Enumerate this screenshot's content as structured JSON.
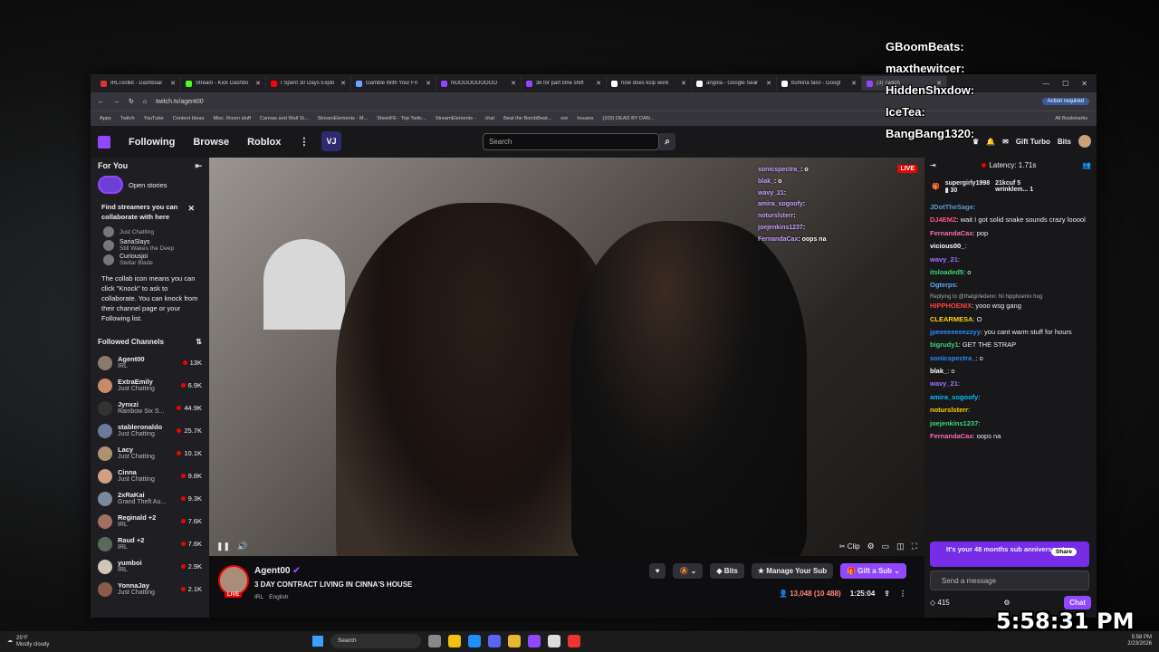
{
  "browser": {
    "tabs": [
      {
        "title": "IRLToolkit - Dashboar",
        "color": "#d33"
      },
      {
        "title": "Stream - Kick Dashbo",
        "color": "#53fc18"
      },
      {
        "title": "I Spent 30 Days Explo",
        "color": "#f00"
      },
      {
        "title": "Gamble With Your Fri",
        "color": "#6af"
      },
      {
        "title": "NOOOOOOOOOO",
        "color": "#9147ff"
      },
      {
        "title": "3k for part time shift",
        "color": "#9147ff"
      },
      {
        "title": "how does kcip work",
        "color": "#fff"
      },
      {
        "title": "angola - Google Sear",
        "color": "#fff"
      },
      {
        "title": "burkina faso - Googl",
        "color": "#fff"
      },
      {
        "title": "(3) Twitch",
        "color": "#9147ff"
      }
    ],
    "url": "twitch.tv/agent00",
    "action_required": "Action required",
    "bookmarks": [
      "Apps",
      "Twitch",
      "YouTube",
      "Content Ideas",
      "Misc. Room stuff",
      "Canvas and Wall St...",
      "StreamElements - M...",
      "SheetFE - Top Twitc...",
      "StreamElements -",
      "chat",
      "Beat the BombBeat...",
      "oor",
      "houses",
      "(103) DEAD BY DAN..."
    ],
    "all_bookmarks": "All Bookmarks"
  },
  "nav": {
    "following": "Following",
    "browse": "Browse",
    "roblox": "Roblox",
    "more": "⋮",
    "extension": "VJ",
    "search_placeholder": "Search",
    "gift_turbo": "Gift Turbo",
    "bits": "Bits"
  },
  "sidebar": {
    "for_you": "For You",
    "open_stories": "Open stories",
    "collab_heading": "Find streamers you can collaborate with here",
    "collab_list": [
      {
        "name": "",
        "sub": "Just Chatting"
      },
      {
        "name": "SariaSlays",
        "sub": "Still Wakes the Deep"
      },
      {
        "name": "Curiousjoi",
        "sub": "Stellar Blade"
      }
    ],
    "collab_text": "The collab icon means you can click \"Knock\" to ask to collaborate. You can knock from their channel page or your Following list.",
    "followed_heading": "Followed Channels",
    "channels": [
      {
        "name": "Agent00",
        "game": "IRL",
        "viewers": "13K"
      },
      {
        "name": "ExtraEmily",
        "game": "Just Chatting",
        "viewers": "6.9K"
      },
      {
        "name": "Jynxzi",
        "game": "Rainbow Six S...",
        "viewers": "44.9K"
      },
      {
        "name": "stableronaldo",
        "game": "Just Chatting",
        "viewers": "25.7K"
      },
      {
        "name": "Lacy",
        "game": "Just Chatting",
        "viewers": "10.1K"
      },
      {
        "name": "Cinna",
        "game": "Just Chatting",
        "viewers": "9.8K"
      },
      {
        "name": "2xRaKai",
        "game": "Grand Theft Au...",
        "viewers": "9.3K"
      },
      {
        "name": "Reginald +2",
        "game": "IRL",
        "viewers": "7.6K"
      },
      {
        "name": "Raud +2",
        "game": "IRL",
        "viewers": "7.6K"
      },
      {
        "name": "yumboi",
        "game": "IRL",
        "viewers": "2.9K"
      },
      {
        "name": "YonnaJay",
        "game": "Just Chatting",
        "viewers": "2.1K"
      }
    ]
  },
  "video": {
    "live": "LIVE",
    "clip": "Clip",
    "overlay_chat": [
      {
        "user": "sonicspectra_",
        "text": ": o"
      },
      {
        "user": "blak_",
        "text": ": o"
      },
      {
        "user": "wavy_21",
        "text": ":"
      },
      {
        "user": "amira_sogoofy",
        "text": ":"
      },
      {
        "user": "noturslsterr",
        "text": ":"
      },
      {
        "user": "joejenkins1237",
        "text": ":"
      },
      {
        "user": "FernandaCax",
        "text": ": oops na"
      }
    ]
  },
  "info": {
    "channel": "Agent00",
    "live": "LIVE",
    "title": "3 DAY CONTRACT LIVING IN CINNA'S HOUSE",
    "tags": [
      "IRL",
      "English"
    ],
    "bits": "Bits",
    "manage_sub": "Manage Your Sub",
    "gift_sub": "Gift a Sub",
    "viewers": "13,048 (10 488)",
    "uptime": "1:25:04"
  },
  "chat": {
    "latency": "Latency: 1.71s",
    "gifter1": {
      "name": "supergirly1998",
      "count": "30"
    },
    "gifter2": {
      "name": "21kcuf",
      "count": "5"
    },
    "gifter3": {
      "name": "wrinklem...",
      "count": "1"
    },
    "messages": [
      {
        "user": "JDotTheSage",
        "text": ":",
        "color": "#5b9bd5"
      },
      {
        "user": "DJ4EMZ",
        "text": ": wait I got solid snake sounds crazy looool",
        "color": "#ff4f8b"
      },
      {
        "user": "FernandaCax",
        "text": ": pop",
        "color": "#ff69b4"
      },
      {
        "user": "vicious00_",
        "text": ":",
        "color": "#fff"
      },
      {
        "user": "wavy_21",
        "text": ":",
        "color": "#a970ff"
      },
      {
        "user": "itsloaded5",
        "text": ": o",
        "color": "#3cd870"
      },
      {
        "user": "Ogterps",
        "text": ":",
        "color": "#5fa8ff"
      },
      {
        "user": "HIPPHOENIX",
        "text": ": yooo  wsg gang",
        "color": "#ff4040",
        "reply": "Replying to @thatgirledenn: hii hipphoenix hug"
      },
      {
        "user": "CLEARMESA",
        "text": ": O",
        "color": "#ffd400"
      },
      {
        "user": "jpeeeeeeeezzyy",
        "text": ": you cant warm stuff for hours",
        "color": "#1e90ff"
      },
      {
        "user": "bigrudy1",
        "text": ": GET THE STRAP",
        "color": "#3cd870"
      },
      {
        "user": "sonicspectra_",
        "text": ": o",
        "color": "#1e90ff"
      },
      {
        "user": "blak_",
        "text": ": o",
        "color": "#fff"
      },
      {
        "user": "wavy_21",
        "text": ":",
        "color": "#a970ff"
      },
      {
        "user": "amira_sogoofy",
        "text": ":",
        "color": "#00bfff"
      },
      {
        "user": "noturslsterr",
        "text": ":",
        "color": "#ffd400"
      },
      {
        "user": "joejenkins1237",
        "text": ":",
        "color": "#3cd870"
      },
      {
        "user": "FernandaCax",
        "text": ": oops na",
        "color": "#ff69b4"
      }
    ],
    "sub_banner": "It's your 48 months sub anniversary!",
    "share": "Share",
    "send_placeholder": "Send a message",
    "points": "415",
    "chat_button": "Chat"
  },
  "stream_overlay": {
    "names": [
      "GBoomBeats:",
      "maxthewitcer:",
      "HiddenShxdow:",
      "IceTea:",
      "BangBang1320:"
    ],
    "clock": "5:58:31 PM"
  },
  "taskbar": {
    "temp": "25°F",
    "weather": "Mostly cloudy",
    "search": "Search",
    "time": "5:58 PM",
    "date": "2/23/2026"
  },
  "colors": {
    "accent": "#9147ff",
    "live": "#eb0400"
  }
}
